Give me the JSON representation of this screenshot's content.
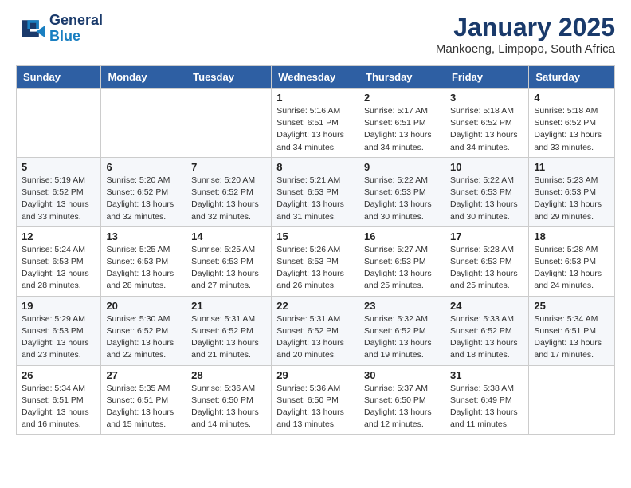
{
  "logo": {
    "line1": "General",
    "line2": "Blue"
  },
  "title": "January 2025",
  "subtitle": "Mankoeng, Limpopo, South Africa",
  "days_of_week": [
    "Sunday",
    "Monday",
    "Tuesday",
    "Wednesday",
    "Thursday",
    "Friday",
    "Saturday"
  ],
  "weeks": [
    [
      {
        "day": "",
        "info": ""
      },
      {
        "day": "",
        "info": ""
      },
      {
        "day": "",
        "info": ""
      },
      {
        "day": "1",
        "info": "Sunrise: 5:16 AM\nSunset: 6:51 PM\nDaylight: 13 hours\nand 34 minutes."
      },
      {
        "day": "2",
        "info": "Sunrise: 5:17 AM\nSunset: 6:51 PM\nDaylight: 13 hours\nand 34 minutes."
      },
      {
        "day": "3",
        "info": "Sunrise: 5:18 AM\nSunset: 6:52 PM\nDaylight: 13 hours\nand 34 minutes."
      },
      {
        "day": "4",
        "info": "Sunrise: 5:18 AM\nSunset: 6:52 PM\nDaylight: 13 hours\nand 33 minutes."
      }
    ],
    [
      {
        "day": "5",
        "info": "Sunrise: 5:19 AM\nSunset: 6:52 PM\nDaylight: 13 hours\nand 33 minutes."
      },
      {
        "day": "6",
        "info": "Sunrise: 5:20 AM\nSunset: 6:52 PM\nDaylight: 13 hours\nand 32 minutes."
      },
      {
        "day": "7",
        "info": "Sunrise: 5:20 AM\nSunset: 6:52 PM\nDaylight: 13 hours\nand 32 minutes."
      },
      {
        "day": "8",
        "info": "Sunrise: 5:21 AM\nSunset: 6:53 PM\nDaylight: 13 hours\nand 31 minutes."
      },
      {
        "day": "9",
        "info": "Sunrise: 5:22 AM\nSunset: 6:53 PM\nDaylight: 13 hours\nand 30 minutes."
      },
      {
        "day": "10",
        "info": "Sunrise: 5:22 AM\nSunset: 6:53 PM\nDaylight: 13 hours\nand 30 minutes."
      },
      {
        "day": "11",
        "info": "Sunrise: 5:23 AM\nSunset: 6:53 PM\nDaylight: 13 hours\nand 29 minutes."
      }
    ],
    [
      {
        "day": "12",
        "info": "Sunrise: 5:24 AM\nSunset: 6:53 PM\nDaylight: 13 hours\nand 28 minutes."
      },
      {
        "day": "13",
        "info": "Sunrise: 5:25 AM\nSunset: 6:53 PM\nDaylight: 13 hours\nand 28 minutes."
      },
      {
        "day": "14",
        "info": "Sunrise: 5:25 AM\nSunset: 6:53 PM\nDaylight: 13 hours\nand 27 minutes."
      },
      {
        "day": "15",
        "info": "Sunrise: 5:26 AM\nSunset: 6:53 PM\nDaylight: 13 hours\nand 26 minutes."
      },
      {
        "day": "16",
        "info": "Sunrise: 5:27 AM\nSunset: 6:53 PM\nDaylight: 13 hours\nand 25 minutes."
      },
      {
        "day": "17",
        "info": "Sunrise: 5:28 AM\nSunset: 6:53 PM\nDaylight: 13 hours\nand 25 minutes."
      },
      {
        "day": "18",
        "info": "Sunrise: 5:28 AM\nSunset: 6:53 PM\nDaylight: 13 hours\nand 24 minutes."
      }
    ],
    [
      {
        "day": "19",
        "info": "Sunrise: 5:29 AM\nSunset: 6:53 PM\nDaylight: 13 hours\nand 23 minutes."
      },
      {
        "day": "20",
        "info": "Sunrise: 5:30 AM\nSunset: 6:52 PM\nDaylight: 13 hours\nand 22 minutes."
      },
      {
        "day": "21",
        "info": "Sunrise: 5:31 AM\nSunset: 6:52 PM\nDaylight: 13 hours\nand 21 minutes."
      },
      {
        "day": "22",
        "info": "Sunrise: 5:31 AM\nSunset: 6:52 PM\nDaylight: 13 hours\nand 20 minutes."
      },
      {
        "day": "23",
        "info": "Sunrise: 5:32 AM\nSunset: 6:52 PM\nDaylight: 13 hours\nand 19 minutes."
      },
      {
        "day": "24",
        "info": "Sunrise: 5:33 AM\nSunset: 6:52 PM\nDaylight: 13 hours\nand 18 minutes."
      },
      {
        "day": "25",
        "info": "Sunrise: 5:34 AM\nSunset: 6:51 PM\nDaylight: 13 hours\nand 17 minutes."
      }
    ],
    [
      {
        "day": "26",
        "info": "Sunrise: 5:34 AM\nSunset: 6:51 PM\nDaylight: 13 hours\nand 16 minutes."
      },
      {
        "day": "27",
        "info": "Sunrise: 5:35 AM\nSunset: 6:51 PM\nDaylight: 13 hours\nand 15 minutes."
      },
      {
        "day": "28",
        "info": "Sunrise: 5:36 AM\nSunset: 6:50 PM\nDaylight: 13 hours\nand 14 minutes."
      },
      {
        "day": "29",
        "info": "Sunrise: 5:36 AM\nSunset: 6:50 PM\nDaylight: 13 hours\nand 13 minutes."
      },
      {
        "day": "30",
        "info": "Sunrise: 5:37 AM\nSunset: 6:50 PM\nDaylight: 13 hours\nand 12 minutes."
      },
      {
        "day": "31",
        "info": "Sunrise: 5:38 AM\nSunset: 6:49 PM\nDaylight: 13 hours\nand 11 minutes."
      },
      {
        "day": "",
        "info": ""
      }
    ]
  ]
}
